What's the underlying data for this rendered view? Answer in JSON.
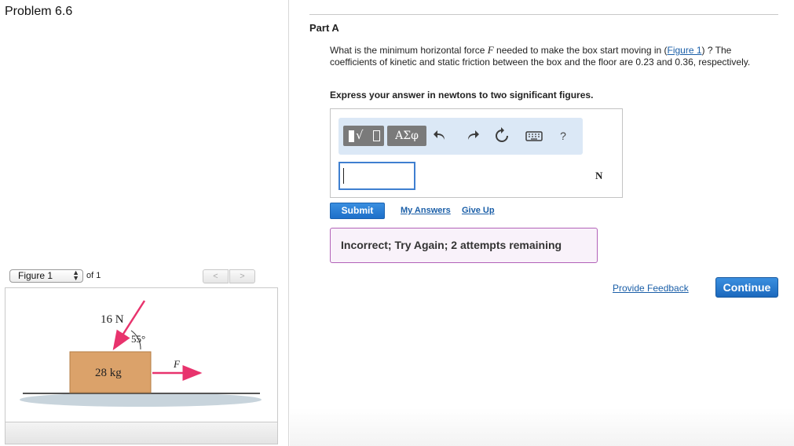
{
  "problem": {
    "title": "Problem 6.6"
  },
  "figure_nav": {
    "selected": "Figure 1",
    "of_label": "of 1",
    "prev_icon": "chevron-left-icon",
    "next_icon": "chevron-right-icon"
  },
  "figure": {
    "force_label": "16 N",
    "angle_label": "55°",
    "mass_label": "28 kg",
    "applied_force_label": "F",
    "colors": {
      "box": "#dba26a",
      "arrow": "#e8336d",
      "floor": "#c8d4dc"
    }
  },
  "part": {
    "title": "Part A",
    "question_pre": "What is the minimum horizontal force ",
    "question_var": "F",
    "question_mid": " needed to make the box start moving in (",
    "question_link": "Figure 1",
    "question_post": ") ? The coefficients of kinetic and static friction between the box and the floor are 0.23 and 0.36, respectively.",
    "instruction": "Express your answer in newtons to two significant figures."
  },
  "toolbar": {
    "template_radical": "√",
    "greek_label": "ΑΣφ",
    "undo_icon": "undo-icon",
    "redo_icon": "redo-icon",
    "reset_icon": "reset-icon",
    "keyboard_icon": "keyboard-icon",
    "help_label": "?"
  },
  "answer": {
    "value": "",
    "unit": "N"
  },
  "actions": {
    "submit": "Submit",
    "my_answers": "My Answers",
    "give_up": "Give Up"
  },
  "feedback": {
    "message": "Incorrect; Try Again; 2 attempts remaining"
  },
  "footer": {
    "provide_feedback": "Provide Feedback",
    "continue": "Continue"
  }
}
